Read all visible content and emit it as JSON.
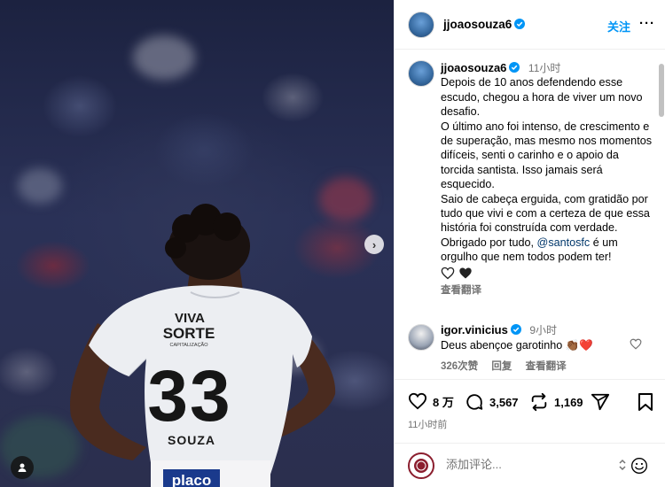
{
  "post": {
    "author": "jjoaosouza6",
    "follow_label": "关注",
    "more_label": "···",
    "caption": {
      "username": "jjoaosouza6",
      "time": "11小时",
      "text": "Depois de 10 anos defendendo esse escudo, chegou a hora de viver um novo desafio.\nO último ano foi intenso, de crescimento e de superação, mas mesmo nos momentos difíceis, senti o carinho e o apoio da torcida santista. Isso jamais será esquecido.\nSaio de cabeça erguida, com gratidão por tudo que vivi e com a certeza de que essa história foi construída com verdade.\nObrigado por tudo, ",
      "mention": "@santosfc",
      "text_after": " é um orgulho que nem todos podem ter!",
      "translate_label": "查看翻译"
    },
    "comments": [
      {
        "username": "igor.vinicius",
        "time": "9小时",
        "text": "Deus abençoe garotinho 👏🏾❤️",
        "likes": "326次赞",
        "reply_label": "回复",
        "translate_label": "查看翻译"
      }
    ],
    "actions": {
      "likes": "8 万",
      "comments": "3,567",
      "reposts": "1,169"
    },
    "posted_ago": "11小时前",
    "add_comment_placeholder": "添加评论..."
  },
  "photo": {
    "jersey_sponsor_line1": "VIVA",
    "jersey_sponsor_line2": "SORTE",
    "jersey_sponsor_sub": "CAPITALIZAÇÃO",
    "jersey_number": "33",
    "jersey_name": "SOUZA",
    "jersey_bottom_sponsor": "placo"
  },
  "colors": {
    "link_blue": "#0095f6",
    "mention_blue": "#00376b",
    "heart_red": "#ed4956",
    "verified_blue": "#0095f6"
  },
  "icons": [
    "verified-icon",
    "heart-icon",
    "comment-icon",
    "repost-icon",
    "share-icon",
    "bookmark-icon",
    "chevron-right-icon",
    "tag-user-icon",
    "emoji-icon"
  ]
}
